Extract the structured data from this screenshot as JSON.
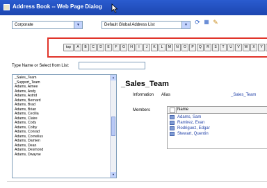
{
  "window": {
    "title": "Address Book -- Web Page Dialog"
  },
  "toolbar": {
    "book_select": "Corporate",
    "list_select": "Default Global Address List",
    "icons": [
      "refresh-icon",
      "view-icon",
      "options-icon"
    ]
  },
  "alphabet": {
    "items": [
      "top",
      "A",
      "B",
      "C",
      "D",
      "E",
      "F",
      "G",
      "H",
      "I",
      "J",
      "K",
      "L",
      "M",
      "N",
      "O",
      "P",
      "Q",
      "R",
      "S",
      "T",
      "U",
      "V",
      "W",
      "X",
      "Y",
      "Z"
    ]
  },
  "search": {
    "label": "Type Name or Select from List:",
    "value": ""
  },
  "names": {
    "items": [
      "_Sales_Team",
      "_Support_Team",
      "Adams, Aimee",
      "Adams, Andy",
      "Adams, Astrid",
      "Adams, Bernard",
      "Adams, Brad",
      "Adams, Brian",
      "Adams, Cecilia",
      "Adams, Claire",
      "Adams, Cody",
      "Adams, Colby",
      "Adams, Conrad",
      "Adams, Cornelius",
      "Adams, Damien",
      "Adams, Dean",
      "Adams, Desmond",
      "Adams, Dwayne"
    ],
    "selected": "_Sales_Team"
  },
  "details": {
    "heading": "_Sales_Team",
    "information_label": "Information",
    "alias_label": "Alias",
    "alias_value": "_Sales_Team",
    "members_label": "Members",
    "members_header": "Name",
    "members": [
      "Adams, Sam",
      "Ramirez, Evan",
      "Rodriguez, Edgar",
      "Stewart, Quentin"
    ]
  }
}
